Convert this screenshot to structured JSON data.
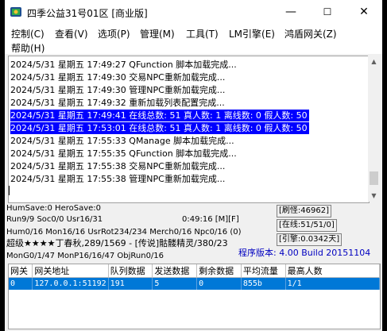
{
  "window": {
    "title": "四季公益31号01区 [商业版]",
    "controls": {
      "minimize": "—",
      "maximize": "☐",
      "close": "✕"
    }
  },
  "menu": [
    {
      "label": "控制(C)"
    },
    {
      "label": "查看(V)"
    },
    {
      "label": "选项(P)"
    },
    {
      "label": "管理(M)"
    },
    {
      "label": "工具(T)"
    },
    {
      "label": "LM引擎(E)"
    },
    {
      "label": "鸿盾网关(Z)"
    },
    {
      "label": "帮助(H)"
    }
  ],
  "log": [
    {
      "text": "2024/5/31 星期五 17:49:27 QFunction 脚本加载完成...",
      "selected": false
    },
    {
      "text": "2024/5/31 星期五 17:49:30 交易NPC重新加载完成...",
      "selected": false
    },
    {
      "text": "2024/5/31 星期五 17:49:30 管理NPC重新加载完成...",
      "selected": false
    },
    {
      "text": "2024/5/31 星期五 17:49:32 重新加载列表配置完成...",
      "selected": false
    },
    {
      "text": "2024/5/31 星期五 17:49:41 在线总数: 51 真人数: 1 离线数: 0 假人数: 50",
      "selected": true
    },
    {
      "text": "2024/5/31 星期五 17:53:01 在线总数: 51 真人数: 1 离线数: 0 假人数: 50",
      "selected": true
    },
    {
      "text": "2024/5/31 星期五 17:55:33 QManage 脚本加载完成...",
      "selected": false
    },
    {
      "text": "2024/5/31 星期五 17:55:35 QFunction 脚本加载完成...",
      "selected": false
    },
    {
      "text": "2024/5/31 星期五 17:55:38 交易NPC重新加载完成...",
      "selected": false
    },
    {
      "text": "2024/5/31 星期五 17:55:38 管理NPC重新加载完成...",
      "selected": false
    }
  ],
  "status": {
    "hum_save": "HumSave:0 HeroSave:0",
    "run": "Run9/9 Soc0/0 Usr16/31",
    "time": "0:49:16 [M][F]",
    "refresh_monster": "[刷怪:46962]",
    "hum_line": "Hum0/16 Mon16/16 UsrRot234/234 Merch0/16 Npc0/16 (0)",
    "online": "[在线:51/51/0]",
    "announce": "超级★★★★丁春秋,289/1569 - [传说]骷髅精灵/380/23",
    "refresh_rate": "[引擎:0.0342天]",
    "mon_line": "MonG0/1/47 MonP16/16/47 ObjRun0/16",
    "version": "程序版本: 4.00 Build 20151104"
  },
  "grid": {
    "columns": [
      "网关",
      "网关地址",
      "队列数据",
      "发送数据",
      "剩余数据",
      "平均流量",
      "最高人数"
    ],
    "rows": [
      [
        "0",
        "127.0.0.1:51192",
        "191",
        "5",
        "0",
        "855b",
        "1/1"
      ]
    ]
  },
  "colors": {
    "selection": "#0000ff",
    "grid_selection": "#0078d7",
    "version": "#0000c0"
  }
}
